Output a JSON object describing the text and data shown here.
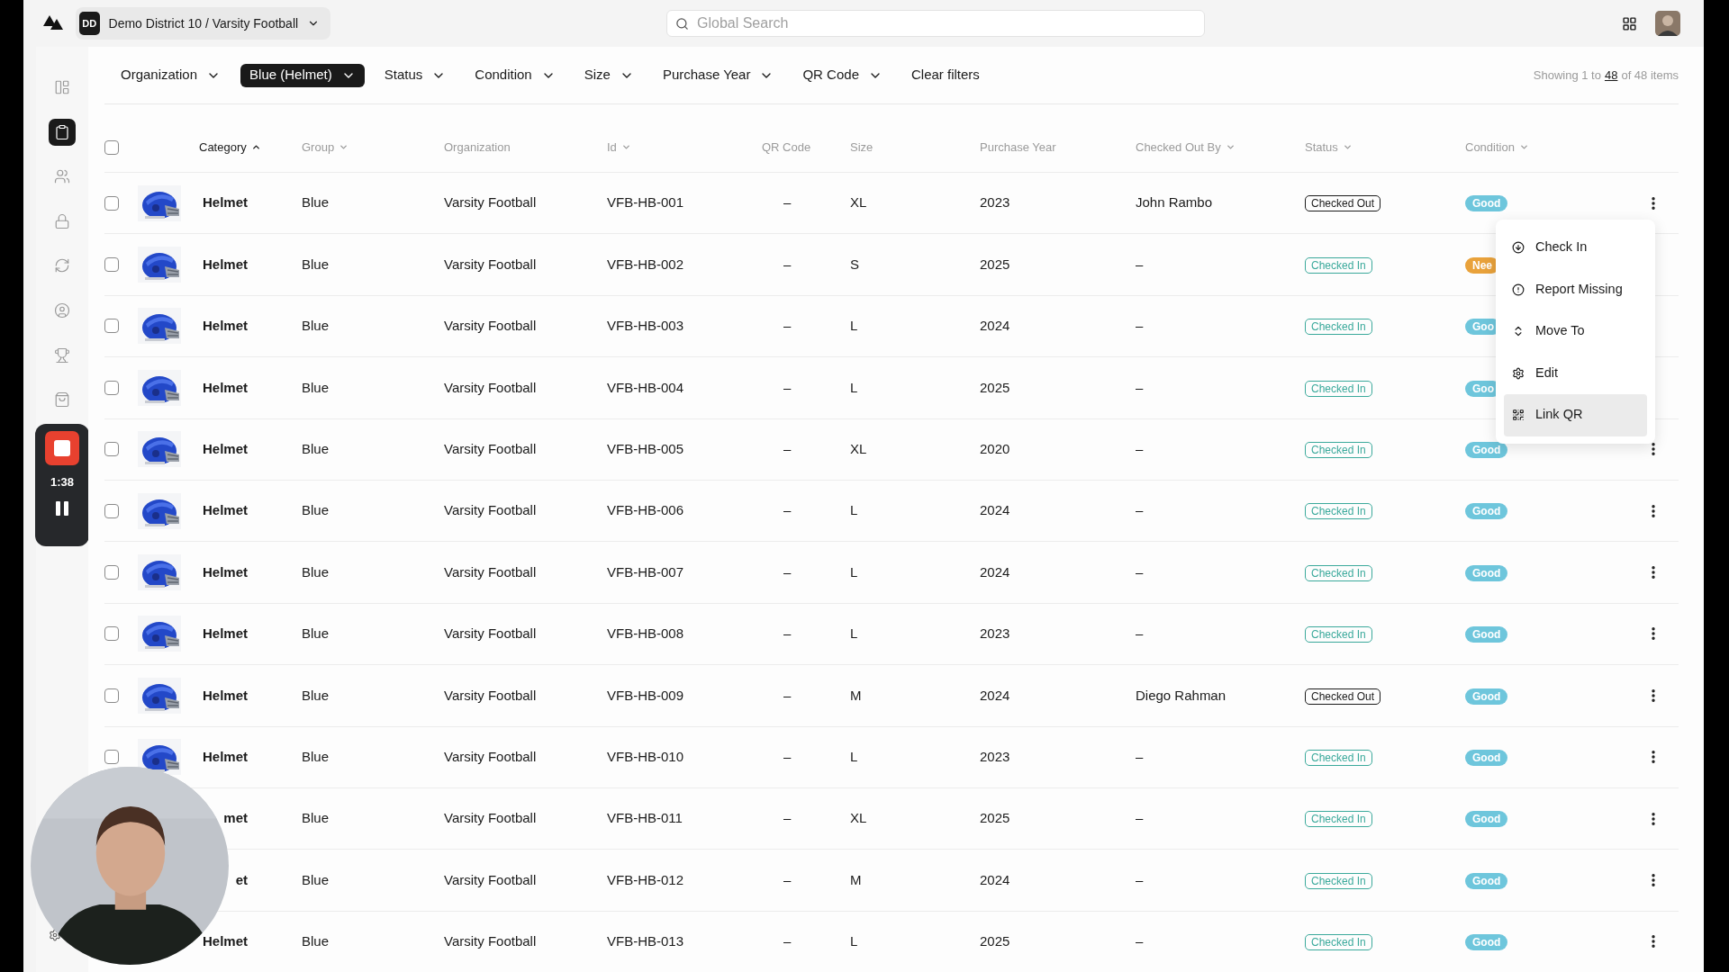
{
  "topbar": {
    "workspace": {
      "initials": "DD",
      "name": "Demo District 10 / Varsity Football"
    },
    "search": {
      "placeholder": "Global Search"
    }
  },
  "sidebar": {
    "items": [
      {
        "selected": false
      },
      {
        "selected": true
      },
      {
        "selected": false
      },
      {
        "selected": false
      },
      {
        "selected": false
      },
      {
        "selected": false
      },
      {
        "selected": false
      },
      {
        "selected": false
      }
    ]
  },
  "recorder": {
    "time": "1:38"
  },
  "filters": [
    {
      "label": "Organization",
      "selected": false,
      "kind": "dropdown"
    },
    {
      "label": "Blue (Helmet)",
      "selected": true,
      "kind": "dropdown"
    },
    {
      "label": "Status",
      "selected": false,
      "kind": "dropdown"
    },
    {
      "label": "Condition",
      "selected": false,
      "kind": "dropdown"
    },
    {
      "label": "Size",
      "selected": false,
      "kind": "dropdown"
    },
    {
      "label": "Purchase Year",
      "selected": false,
      "kind": "dropdown"
    },
    {
      "label": "QR Code",
      "selected": false,
      "kind": "dropdown"
    },
    {
      "label": "Clear filters",
      "selected": false,
      "kind": "link"
    }
  ],
  "summary": {
    "prefix": "Showing 1 to",
    "link": "48",
    "suffix": "of 48 items"
  },
  "table": {
    "select_all": {
      "checked": false
    },
    "columns": [
      {
        "label": "Category",
        "sortable": true,
        "sorted": true
      },
      {
        "label": "Group",
        "sortable": true,
        "sorted": false
      },
      {
        "label": "Organization",
        "sortable": false,
        "sorted": false
      },
      {
        "label": "Id",
        "sortable": true,
        "sorted": false
      },
      {
        "label": "QR Code",
        "sortable": false,
        "sorted": false
      },
      {
        "label": "Size",
        "sortable": false,
        "sorted": false
      },
      {
        "label": "Purchase Year",
        "sortable": false,
        "sorted": false
      },
      {
        "label": "Checked Out By",
        "sortable": true,
        "sorted": false
      },
      {
        "label": "Status",
        "sortable": true,
        "sorted": false
      },
      {
        "label": "Condition",
        "sortable": true,
        "sorted": false
      }
    ],
    "rows": [
      {
        "kind": "plain",
        "checked": false,
        "category": "Helmet",
        "group": "Blue",
        "organization": "Varsity Football",
        "id": "VFB-HB-001",
        "qr_code": "–",
        "size": "XL",
        "purchase_year": "2023",
        "checked_out_by": "John Rambo",
        "status": {
          "text": "Checked Out",
          "color": "#1a1a1a"
        },
        "condition": {
          "text": "Good",
          "color": "#6ec6dc"
        }
      },
      {
        "kind": "under-menu",
        "checked": false,
        "category": "Helmet",
        "group": "Blue",
        "organization": "Varsity Football",
        "id": "VFB-HB-002",
        "qr_code": "–",
        "size": "S",
        "purchase_year": "2025",
        "checked_out_by": "–",
        "status": {
          "text": "Checked In",
          "color": "#3aa99b"
        },
        "condition": {
          "text": "Nee",
          "color": "#e9a23b"
        }
      },
      {
        "kind": "under-menu",
        "checked": false,
        "category": "Helmet",
        "group": "Blue",
        "organization": "Varsity Football",
        "id": "VFB-HB-003",
        "qr_code": "–",
        "size": "L",
        "purchase_year": "2024",
        "checked_out_by": "–",
        "status": {
          "text": "Checked In",
          "color": "#3aa99b"
        },
        "condition": {
          "text": "Goo",
          "color": "#6ec6dc"
        }
      },
      {
        "kind": "under-menu",
        "checked": false,
        "category": "Helmet",
        "group": "Blue",
        "organization": "Varsity Football",
        "id": "VFB-HB-004",
        "qr_code": "–",
        "size": "L",
        "purchase_year": "2025",
        "checked_out_by": "–",
        "status": {
          "text": "Checked In",
          "color": "#3aa99b"
        },
        "condition": {
          "text": "Goo",
          "color": "#6ec6dc"
        }
      },
      {
        "kind": "plain",
        "checked": false,
        "category": "Helmet",
        "group": "Blue",
        "organization": "Varsity Football",
        "id": "VFB-HB-005",
        "qr_code": "–",
        "size": "XL",
        "purchase_year": "2020",
        "checked_out_by": "–",
        "status": {
          "text": "Checked In",
          "color": "#3aa99b"
        },
        "condition": {
          "text": "Good",
          "color": "#6ec6dc"
        }
      },
      {
        "kind": "plain",
        "checked": false,
        "category": "Helmet",
        "group": "Blue",
        "organization": "Varsity Football",
        "id": "VFB-HB-006",
        "qr_code": "–",
        "size": "L",
        "purchase_year": "2024",
        "checked_out_by": "–",
        "status": {
          "text": "Checked In",
          "color": "#3aa99b"
        },
        "condition": {
          "text": "Good",
          "color": "#6ec6dc"
        }
      },
      {
        "kind": "plain",
        "checked": false,
        "category": "Helmet",
        "group": "Blue",
        "organization": "Varsity Football",
        "id": "VFB-HB-007",
        "qr_code": "–",
        "size": "L",
        "purchase_year": "2024",
        "checked_out_by": "–",
        "status": {
          "text": "Checked In",
          "color": "#3aa99b"
        },
        "condition": {
          "text": "Good",
          "color": "#6ec6dc"
        }
      },
      {
        "kind": "plain",
        "checked": false,
        "category": "Helmet",
        "group": "Blue",
        "organization": "Varsity Football",
        "id": "VFB-HB-008",
        "qr_code": "–",
        "size": "L",
        "purchase_year": "2023",
        "checked_out_by": "–",
        "status": {
          "text": "Checked In",
          "color": "#3aa99b"
        },
        "condition": {
          "text": "Good",
          "color": "#6ec6dc"
        }
      },
      {
        "kind": "plain",
        "checked": false,
        "category": "Helmet",
        "group": "Blue",
        "organization": "Varsity Football",
        "id": "VFB-HB-009",
        "qr_code": "–",
        "size": "M",
        "purchase_year": "2024",
        "checked_out_by": "Diego Rahman",
        "status": {
          "text": "Checked Out",
          "color": "#1a1a1a"
        },
        "condition": {
          "text": "Good",
          "color": "#6ec6dc"
        }
      },
      {
        "kind": "plain",
        "checked": false,
        "category": "Helmet",
        "group": "Blue",
        "organization": "Varsity Football",
        "id": "VFB-HB-010",
        "qr_code": "–",
        "size": "L",
        "purchase_year": "2023",
        "checked_out_by": "–",
        "status": {
          "text": "Checked In",
          "color": "#3aa99b"
        },
        "condition": {
          "text": "Good",
          "color": "#6ec6dc"
        }
      },
      {
        "kind": "under-camera",
        "category": "met",
        "group": "Blue",
        "organization": "Varsity Football",
        "id": "VFB-HB-011",
        "qr_code": "–",
        "size": "XL",
        "purchase_year": "2025",
        "checked_out_by": "–",
        "status": {
          "text": "Checked In",
          "color": "#3aa99b"
        },
        "condition": {
          "text": "Good",
          "color": "#6ec6dc"
        }
      },
      {
        "kind": "under-camera",
        "category": "et",
        "group": "Blue",
        "organization": "Varsity Football",
        "id": "VFB-HB-012",
        "qr_code": "–",
        "size": "M",
        "purchase_year": "2024",
        "checked_out_by": "–",
        "status": {
          "text": "Checked In",
          "color": "#3aa99b"
        },
        "condition": {
          "text": "Good",
          "color": "#6ec6dc"
        }
      },
      {
        "kind": "under-camera",
        "category": "Helmet",
        "group": "Blue",
        "organization": "Varsity Football",
        "id": "VFB-HB-013",
        "qr_code": "–",
        "size": "L",
        "purchase_year": "2025",
        "checked_out_by": "–",
        "status": {
          "text": "Checked In",
          "color": "#3aa99b"
        },
        "condition": {
          "text": "Good",
          "color": "#6ec6dc"
        }
      }
    ]
  },
  "row_menu": {
    "items": [
      {
        "label": "Check In",
        "highlighted": false
      },
      {
        "label": "Report Missing",
        "highlighted": false
      },
      {
        "label": "Move To",
        "highlighted": false
      },
      {
        "label": "Edit",
        "highlighted": false
      },
      {
        "label": "Link QR",
        "highlighted": true
      }
    ]
  }
}
